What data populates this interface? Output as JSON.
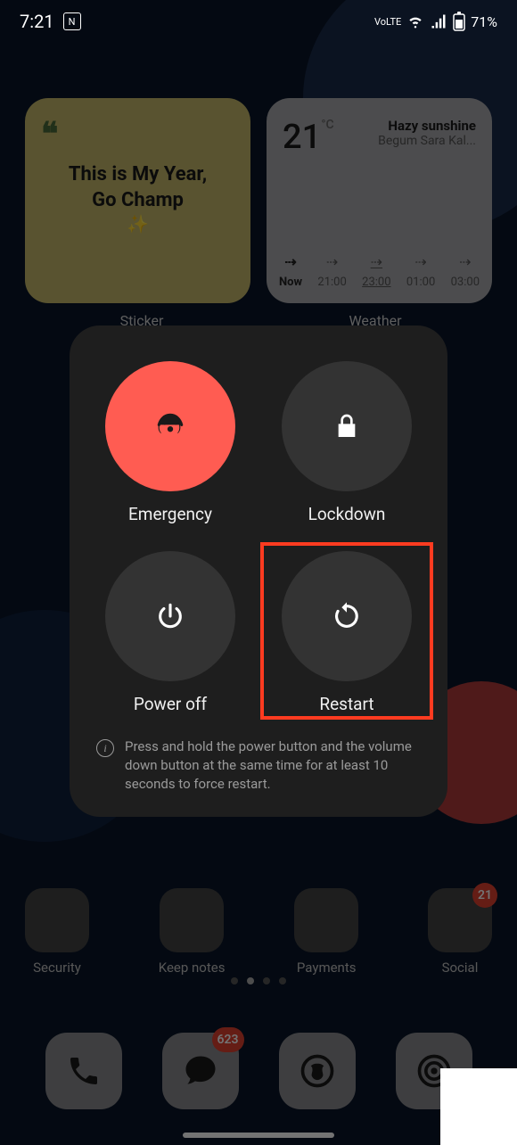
{
  "status": {
    "time": "7:21",
    "volte": "VoLTE",
    "battery": "71%"
  },
  "widgets": {
    "sticker": {
      "quote": "❝",
      "text": "This is My Year,\nGo Champ",
      "emoji": "✨",
      "label": "Sticker"
    },
    "weather": {
      "temp": "21",
      "unit": "°C",
      "desc": "Hazy sunshine",
      "location": "Begum Sara Kal...",
      "label": "Weather",
      "forecast": [
        {
          "time": "Now",
          "cls": "now"
        },
        {
          "time": "21:00"
        },
        {
          "time": "23:00",
          "cls": "sel"
        },
        {
          "time": "01:00"
        },
        {
          "time": "03:00"
        }
      ]
    }
  },
  "apps_row": [
    {
      "label": "Security"
    },
    {
      "label": "Keep notes"
    },
    {
      "label": "Payments"
    },
    {
      "label": "Social",
      "badge": "21"
    }
  ],
  "dock_badges": {
    "messages": "623"
  },
  "power_menu": {
    "items": [
      {
        "key": "emergency",
        "label": "Emergency",
        "red": true,
        "icon": "emergency"
      },
      {
        "key": "lockdown",
        "label": "Lockdown",
        "icon": "lock"
      },
      {
        "key": "poweroff",
        "label": "Power off",
        "icon": "power"
      },
      {
        "key": "restart",
        "label": "Restart",
        "icon": "restart",
        "highlighted": true
      }
    ],
    "hint": "Press and hold the power button and the volume down button at the same time for at least 10 seconds to force restart."
  }
}
